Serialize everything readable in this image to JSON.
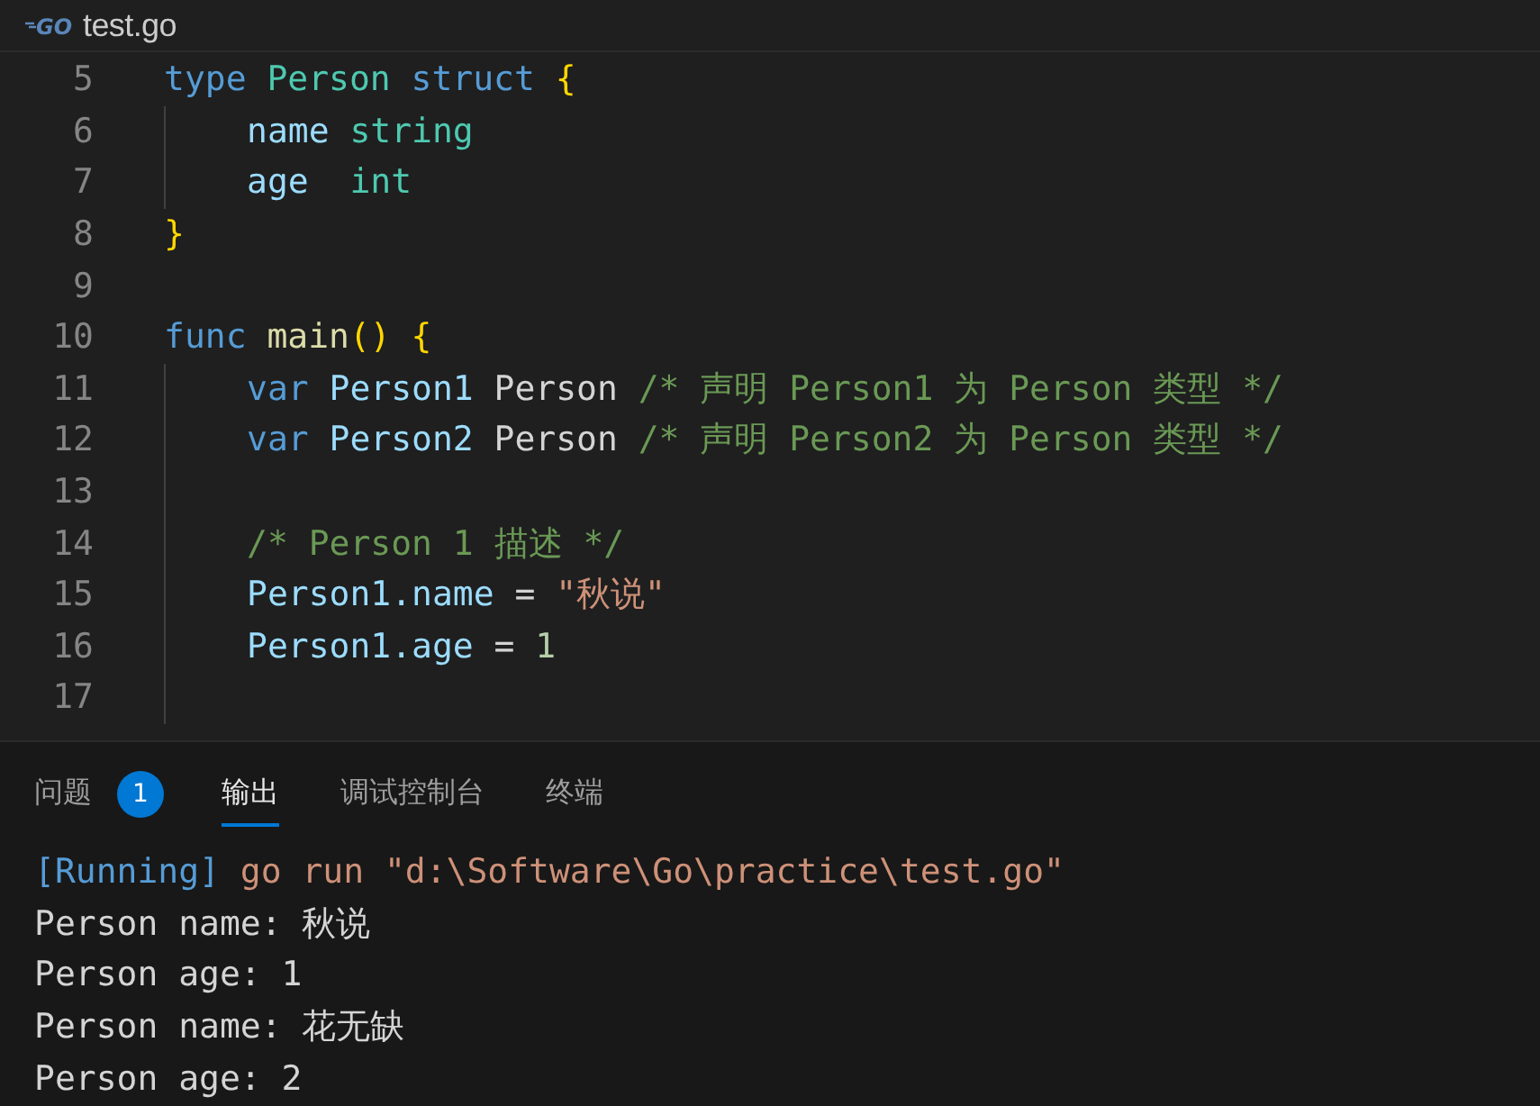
{
  "editor": {
    "file_icon": "GO",
    "file_name": "test.go",
    "lines": [
      {
        "number": "5",
        "indented": false,
        "tokens": [
          {
            "t": "type ",
            "kind": "kw"
          },
          {
            "t": "Person ",
            "kind": "type"
          },
          {
            "t": "struct ",
            "kind": "kw"
          },
          {
            "t": "{",
            "kind": "brace"
          }
        ]
      },
      {
        "number": "6",
        "indented": true,
        "tokens": [
          {
            "t": "name ",
            "kind": "var"
          },
          {
            "t": "string",
            "kind": "type"
          }
        ]
      },
      {
        "number": "7",
        "indented": true,
        "tokens": [
          {
            "t": "age  ",
            "kind": "var"
          },
          {
            "t": "int",
            "kind": "type"
          }
        ]
      },
      {
        "number": "8",
        "indented": false,
        "tokens": [
          {
            "t": "}",
            "kind": "brace"
          }
        ]
      },
      {
        "number": "9",
        "indented": false
      },
      {
        "number": "10",
        "indented": false,
        "tokens": [
          {
            "t": "func ",
            "kind": "kw"
          },
          {
            "t": "main",
            "kind": "fn"
          },
          {
            "t": "() {",
            "kind": "brace"
          }
        ]
      },
      {
        "number": "11",
        "indented": true,
        "tokens": [
          {
            "t": "var ",
            "kind": "kw"
          },
          {
            "t": "Person1 ",
            "kind": "var"
          },
          {
            "t": "Person ",
            "kind": "plain"
          },
          {
            "t": "/* 声明 Person1 为 Person 类型 */",
            "kind": "comment"
          }
        ]
      },
      {
        "number": "12",
        "indented": true,
        "tokens": [
          {
            "t": "var ",
            "kind": "kw"
          },
          {
            "t": "Person2 ",
            "kind": "var"
          },
          {
            "t": "Person ",
            "kind": "plain"
          },
          {
            "t": "/* 声明 Person2 为 Person 类型 */",
            "kind": "comment"
          }
        ]
      },
      {
        "number": "13",
        "indented": true
      },
      {
        "number": "14",
        "indented": true,
        "tokens": [
          {
            "t": "/* Person 1 描述 */",
            "kind": "comment"
          }
        ]
      },
      {
        "number": "15",
        "indented": true,
        "tokens": [
          {
            "t": "Person1.name",
            "kind": "var"
          },
          {
            "t": " = ",
            "kind": "plain"
          },
          {
            "t": "\"秋说\"",
            "kind": "string"
          }
        ]
      },
      {
        "number": "16",
        "indented": true,
        "tokens": [
          {
            "t": "Person1.age",
            "kind": "var"
          },
          {
            "t": " = ",
            "kind": "plain"
          },
          {
            "t": "1",
            "kind": "num"
          }
        ]
      },
      {
        "number": "17",
        "indented": true
      }
    ]
  },
  "panel": {
    "tabs": [
      {
        "label": "问题",
        "selected": false,
        "badge": "1"
      },
      {
        "label": "输出",
        "selected": true
      },
      {
        "label": "调试控制台",
        "selected": false
      },
      {
        "label": "终端",
        "selected": false
      }
    ],
    "output": [
      [
        {
          "t": "[Running]",
          "kind": "kw"
        },
        {
          "t": " go run \"d:\\Software\\Go\\practice\\test.go\"",
          "kind": "string"
        }
      ],
      [
        {
          "t": "Person name: 秋说",
          "kind": "plain"
        }
      ],
      [
        {
          "t": "Person age: 1",
          "kind": "plain"
        }
      ],
      [
        {
          "t": "Person name: 花无缺",
          "kind": "plain"
        }
      ],
      [
        {
          "t": "Person age: 2",
          "kind": "plain"
        }
      ]
    ]
  }
}
